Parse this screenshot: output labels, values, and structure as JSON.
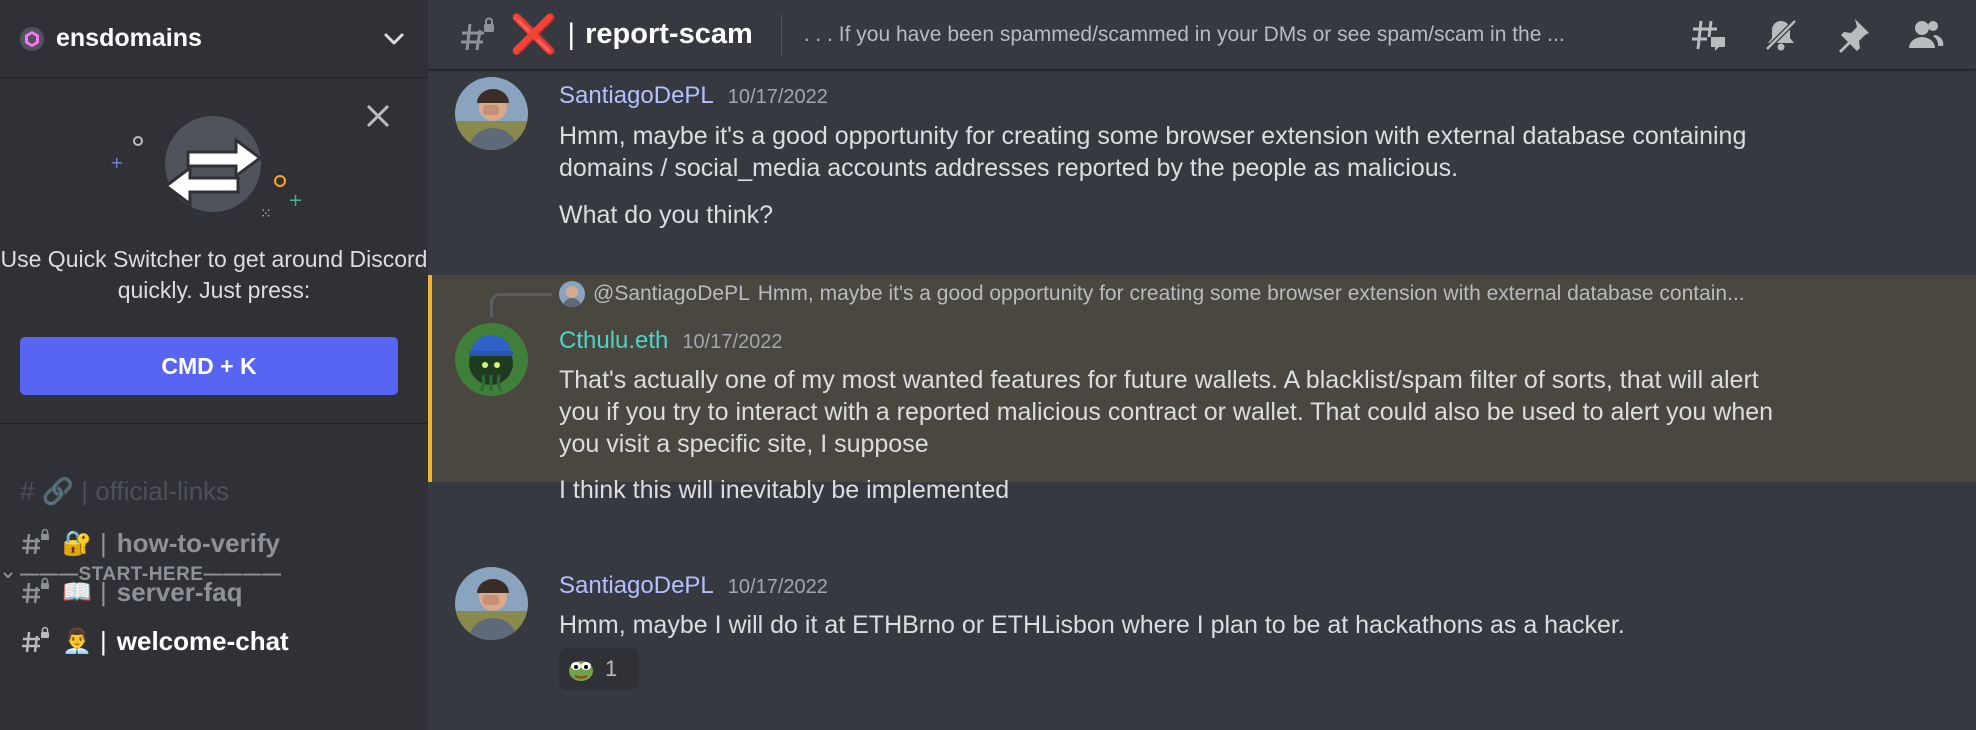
{
  "guild": {
    "name": "ensdomains"
  },
  "quick_switcher": {
    "text": "Use Quick Switcher to get around Discord quickly. Just press:",
    "button_label": "CMD + K"
  },
  "sidebar": {
    "hidden_channel": "# 🔗 | official-links",
    "category": "———START-HERE————",
    "channels": [
      {
        "emoji": "🔐",
        "name": "how-to-verify",
        "active": false
      },
      {
        "emoji": "📖",
        "name": "server-faq",
        "active": false
      },
      {
        "emoji": "👨‍💼",
        "name": "welcome-chat",
        "active": true
      }
    ]
  },
  "channel_header": {
    "prefix_emoji": "❌",
    "separator": "|",
    "name": "report-scam",
    "topic": ". . . If you have been spammed/scammed in your DMs or see spam/scam in the ..."
  },
  "toolbar": {
    "icons": [
      "threads-icon",
      "mute-bell-icon",
      "pin-icon",
      "members-icon"
    ]
  },
  "messages": [
    {
      "author": "SantiagoDePL",
      "timestamp": "10/17/2022",
      "lines": [
        "Hmm, maybe it's a good opportunity for creating some browser extension with external database containing",
        "domains / social_media accounts addresses reported by the people as malicious."
      ],
      "followup": "What do you think?"
    },
    {
      "reply_to_author": "@SantiagoDePL",
      "reply_preview": "Hmm, maybe it's a good opportunity for creating some browser extension with external database contain...",
      "author": "Cthulu.eth",
      "timestamp": "10/17/2022",
      "lines": [
        "That's actually one of my most wanted features for future wallets. A blacklist/spam filter of sorts, that will alert",
        "you if you try to interact with a reported malicious contract or wallet. That could also be used to alert you when",
        "you visit a specific site, I suppose"
      ],
      "followup": "I think this will inevitably be implemented"
    },
    {
      "author": "SantiagoDePL",
      "timestamp": "10/17/2022",
      "lines": [
        "Hmm, maybe I will do it at ETHBrno or ETHLisbon where I plan to be at hackathons as a hacker."
      ],
      "reaction_count": "1"
    }
  ],
  "colors": {
    "accent": "#5865f2",
    "highlight_bar": "#f0b232",
    "author_default": "#b4c0ff",
    "author_teal": "#4fd3c4",
    "cross_red": "#dd2e44"
  }
}
